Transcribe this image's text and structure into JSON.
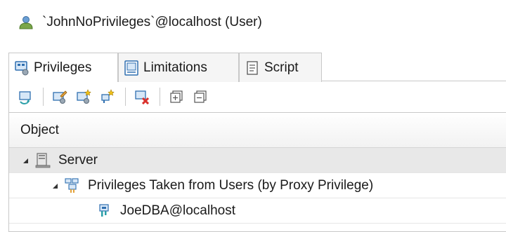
{
  "window": {
    "title": "`JohnNoPrivileges`@localhost (User)",
    "title_icon": "user-icon"
  },
  "tabs": [
    {
      "label": "Privileges",
      "icon": "privileges-icon",
      "active": true
    },
    {
      "label": "Limitations",
      "icon": "limitations-icon",
      "active": false
    },
    {
      "label": "Script",
      "icon": "script-icon",
      "active": false
    }
  ],
  "toolbar": {
    "buttons": [
      {
        "icon": "refresh-icon"
      },
      {
        "icon": "edit-privileges-icon"
      },
      {
        "icon": "grant-privileges-icon"
      },
      {
        "icon": "new-proxy-icon"
      },
      {
        "icon": "revoke-privileges-icon"
      },
      {
        "icon": "expand-all-icon"
      },
      {
        "icon": "collapse-all-icon"
      }
    ]
  },
  "table": {
    "column_header": "Object",
    "rows": [
      {
        "label": "Server",
        "icon": "server-icon",
        "level": 0,
        "expanded": true,
        "selected": true
      },
      {
        "label": "Privileges Taken from Users (by Proxy Privilege)",
        "icon": "proxy-users-icon",
        "level": 1,
        "expanded": true,
        "selected": false
      },
      {
        "label": "JoeDBA@localhost",
        "icon": "proxy-user-icon",
        "level": 2,
        "expanded": null,
        "selected": false
      }
    ]
  },
  "colors": {
    "border": "#c8c8c8",
    "selected_row": "#e8e8e8",
    "icon_blue": "#2f6fb0",
    "icon_teal": "#2a9fa8",
    "icon_red": "#d9302c"
  }
}
